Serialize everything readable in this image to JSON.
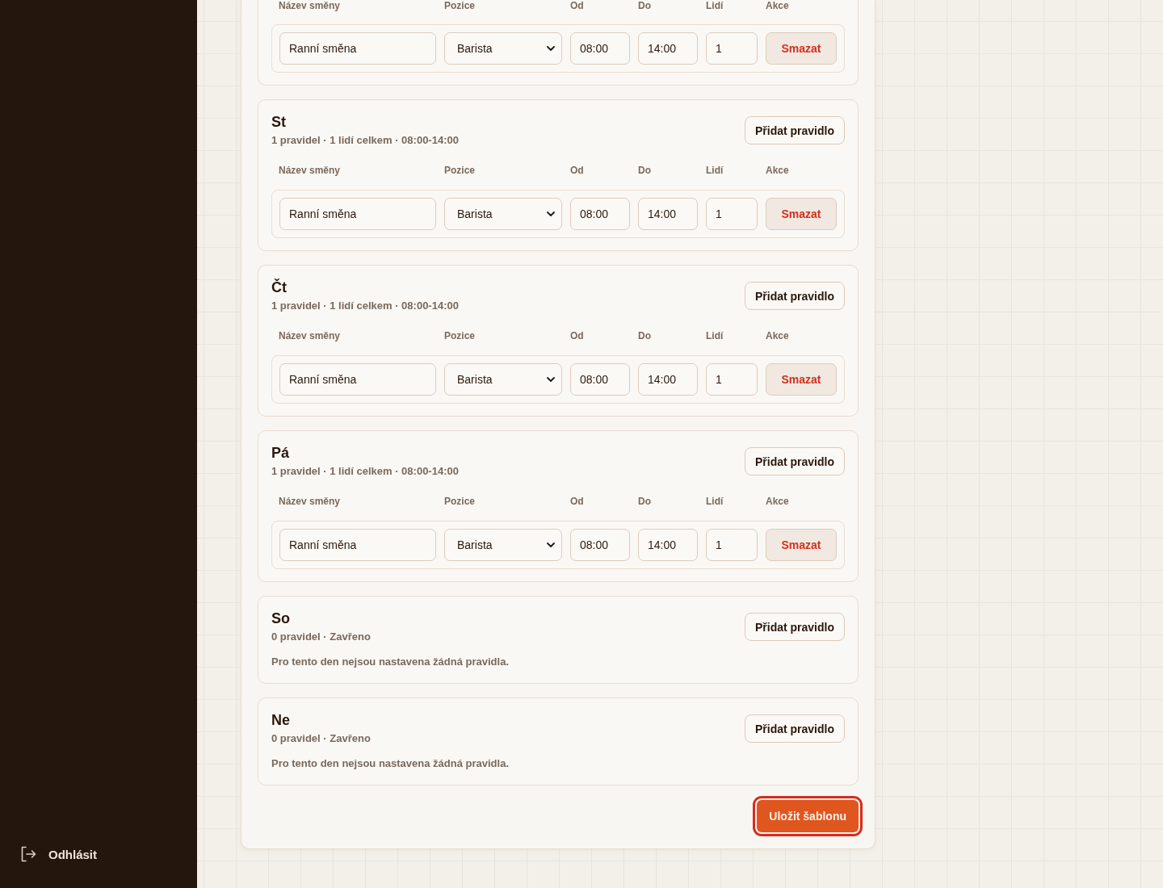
{
  "sidebar": {
    "logout": {
      "label": "Odhlásit"
    }
  },
  "days": [
    {
      "columns": [
        "Název směny",
        "Pozice",
        "Od",
        "Do",
        "Lidí",
        "Akce"
      ],
      "rules": [
        {
          "name": "Ranní směna",
          "position": "Barista",
          "from": "08:00",
          "to": "14:00",
          "people": "1",
          "delete_button": "Smazat"
        }
      ]
    },
    {
      "name": "St",
      "summary": "1 pravidel · 1 lidí celkem · 08:00-14:00",
      "add_button": "Přidat pravidlo",
      "columns": [
        "Název směny",
        "Pozice",
        "Od",
        "Do",
        "Lidí",
        "Akce"
      ],
      "rules": [
        {
          "name": "Ranní směna",
          "position": "Barista",
          "from": "08:00",
          "to": "14:00",
          "people": "1",
          "delete_button": "Smazat"
        }
      ]
    },
    {
      "name": "Čt",
      "summary": "1 pravidel · 1 lidí celkem · 08:00-14:00",
      "add_button": "Přidat pravidlo",
      "columns": [
        "Název směny",
        "Pozice",
        "Od",
        "Do",
        "Lidí",
        "Akce"
      ],
      "rules": [
        {
          "name": "Ranní směna",
          "position": "Barista",
          "from": "08:00",
          "to": "14:00",
          "people": "1",
          "delete_button": "Smazat"
        }
      ]
    },
    {
      "name": "Pá",
      "summary": "1 pravidel · 1 lidí celkem · 08:00-14:00",
      "add_button": "Přidat pravidlo",
      "columns": [
        "Název směny",
        "Pozice",
        "Od",
        "Do",
        "Lidí",
        "Akce"
      ],
      "rules": [
        {
          "name": "Ranní směna",
          "position": "Barista",
          "from": "08:00",
          "to": "14:00",
          "people": "1",
          "delete_button": "Smazat"
        }
      ]
    },
    {
      "name": "So",
      "summary": "0 pravidel · Zavřeno",
      "add_button": "Přidat pravidlo",
      "empty_message": "Pro tento den nejsou nastavena žádná pravidla."
    },
    {
      "name": "Ne",
      "summary": "0 pravidel · Zavřeno",
      "add_button": "Přidat pravidlo",
      "empty_message": "Pro tento den nejsou nastavena žádná pravidla."
    }
  ],
  "save_button": {
    "label": "Uložit šablonu",
    "focused": true
  }
}
